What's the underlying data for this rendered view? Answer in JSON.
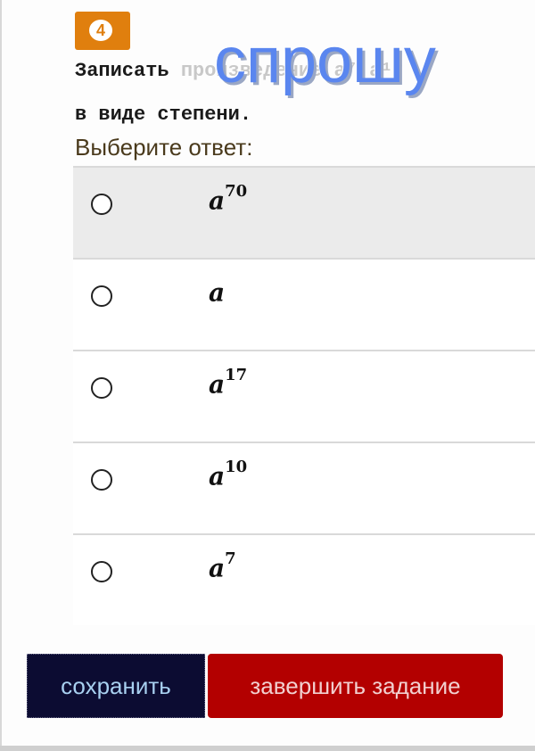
{
  "question": {
    "number": "4",
    "line1_start": "Записать ",
    "line1_obscured": "произведение a⁷·a¹⁰",
    "line2": "в виде степени."
  },
  "watermark": "спрошу",
  "prompt": "Выберите ответ:",
  "options": [
    {
      "base": "a",
      "exp": "70",
      "selected": true
    },
    {
      "base": "a",
      "exp": "",
      "selected": false
    },
    {
      "base": "a",
      "exp": "17",
      "selected": false
    },
    {
      "base": "a",
      "exp": "10",
      "selected": false
    },
    {
      "base": "a",
      "exp": "7",
      "selected": false
    }
  ],
  "buttons": {
    "save": "сохранить",
    "finish": "завершить задание"
  },
  "colors": {
    "badge": "#e07f0e",
    "save_bg": "#0c0c32",
    "finish_bg": "#b30000",
    "watermark": "#5a86ef"
  }
}
